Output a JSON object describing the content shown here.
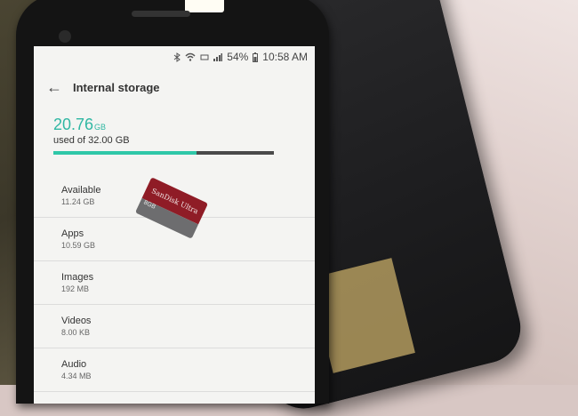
{
  "status_bar": {
    "battery": "54%",
    "time": "10:58 AM",
    "icons": [
      "bluetooth-icon",
      "wifi-icon",
      "lte-icon",
      "signal-icon",
      "battery-icon"
    ]
  },
  "header": {
    "title": "Internal storage"
  },
  "usage": {
    "used_value": "20.76",
    "used_unit": "GB",
    "used_of_text": "used of 32.00 GB",
    "fraction_used": 0.65
  },
  "items": [
    {
      "label": "Available",
      "value": "11.24 GB"
    },
    {
      "label": "Apps",
      "value": "10.59 GB"
    },
    {
      "label": "Images",
      "value": "192 MB"
    },
    {
      "label": "Videos",
      "value": "8.00 KB"
    },
    {
      "label": "Audio",
      "value": "4.34 MB"
    }
  ],
  "sd_card": {
    "brand": "SanDisk Ultra",
    "capacity": "8GB"
  },
  "colors": {
    "accent": "#2fc7a8",
    "bar_track": "#4a4a4a",
    "sd_red": "#8f1c26"
  }
}
